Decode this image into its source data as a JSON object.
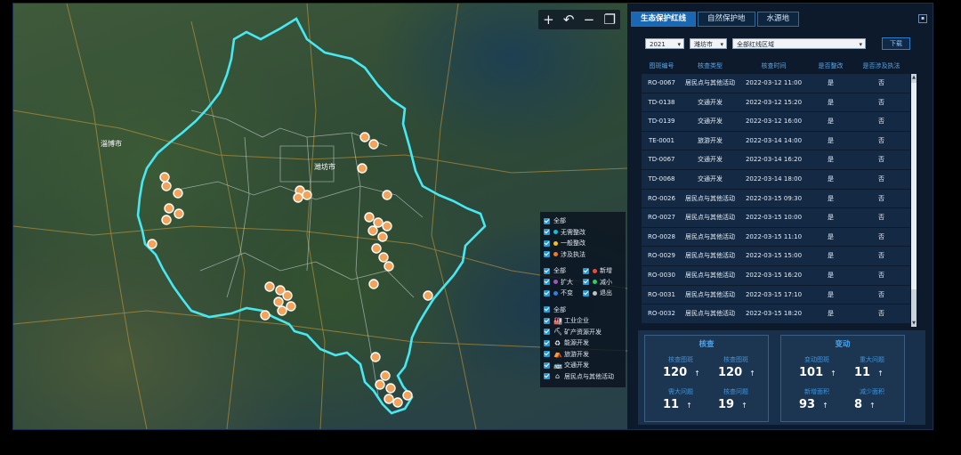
{
  "map": {
    "toolbar": [
      {
        "name": "zoom-in",
        "glyph": "+"
      },
      {
        "name": "undo",
        "glyph": "↶"
      },
      {
        "name": "zoom-out",
        "glyph": "−"
      },
      {
        "name": "layers",
        "glyph": "❐"
      }
    ],
    "city_labels": [
      {
        "name": "zibo",
        "text": "淄博市"
      },
      {
        "name": "weifang",
        "text": "潍坊市"
      }
    ],
    "legend": {
      "group1": [
        {
          "label": "全部",
          "dot": ""
        },
        {
          "label": "无需整改",
          "dot": "#1fb8d8"
        },
        {
          "label": "一般整改",
          "dot": "#f2c21b"
        },
        {
          "label": "涉及执法",
          "dot": "#f07a2a"
        }
      ],
      "group2": [
        [
          {
            "label": "全部",
            "dot": ""
          },
          {
            "label": "新增",
            "dot": "#e74c3c"
          }
        ],
        [
          {
            "label": "扩大",
            "dot": "#9b59b6"
          },
          {
            "label": "减小",
            "dot": "#2ecc71"
          }
        ],
        [
          {
            "label": "不变",
            "dot": "#3b7bdc"
          },
          {
            "label": "退出",
            "dot": "#bdc3c7"
          }
        ]
      ],
      "group3": [
        {
          "label": "全部",
          "icon": ""
        },
        {
          "label": "工业企业",
          "icon": "🏭"
        },
        {
          "label": "矿产资源开发",
          "icon": "⛏"
        },
        {
          "label": "能源开发",
          "icon": "♻"
        },
        {
          "label": "旅游开发",
          "icon": "⛺"
        },
        {
          "label": "交通开发",
          "icon": "🚌"
        },
        {
          "label": "居民点与其他活动",
          "icon": "⌂"
        }
      ]
    }
  },
  "panel": {
    "tabs": [
      "生态保护红线",
      "自然保护地",
      "水源地"
    ],
    "active_tab": 0,
    "filters": {
      "year": "2021",
      "city": "潍坊市",
      "area": "全部红线区域"
    },
    "download_label": "下载",
    "columns": [
      "图斑编号",
      "核查类型",
      "核查时间",
      "是否整改",
      "是否涉及执法"
    ],
    "rows": [
      [
        "RO-0067",
        "居民点与其他活动",
        "2022-03-12 11:00",
        "是",
        "否"
      ],
      [
        "TD-0138",
        "交通开发",
        "2022-03-12 15:20",
        "是",
        "否"
      ],
      [
        "TD-0139",
        "交通开发",
        "2022-03-12 16:00",
        "是",
        "否"
      ],
      [
        "TE-0001",
        "旅游开发",
        "2022-03-14 14:00",
        "是",
        "否"
      ],
      [
        "TD-0067",
        "交通开发",
        "2022-03-14 16:20",
        "是",
        "否"
      ],
      [
        "TD-0068",
        "交通开发",
        "2022-03-14 18:00",
        "是",
        "否"
      ],
      [
        "RO-0026",
        "居民点与其他活动",
        "2022-03-15 09:30",
        "是",
        "否"
      ],
      [
        "RO-0027",
        "居民点与其他活动",
        "2022-03-15 10:00",
        "是",
        "否"
      ],
      [
        "RO-0028",
        "居民点与其他活动",
        "2022-03-15 11:10",
        "是",
        "否"
      ],
      [
        "RO-0029",
        "居民点与其他活动",
        "2022-03-15 15:00",
        "是",
        "否"
      ],
      [
        "RO-0030",
        "居民点与其他活动",
        "2022-03-15 16:20",
        "是",
        "否"
      ],
      [
        "RO-0031",
        "居民点与其他活动",
        "2022-03-15 17:10",
        "是",
        "否"
      ],
      [
        "RO-0032",
        "居民点与其他活动",
        "2022-03-15 18:20",
        "是",
        "否"
      ]
    ],
    "summary": [
      {
        "title": "核查",
        "cells": [
          {
            "label": "核查图斑",
            "value": "120"
          },
          {
            "label": "核查图斑",
            "value": "120"
          },
          {
            "label": "需大问题",
            "value": "11"
          },
          {
            "label": "核查问题",
            "value": "19"
          }
        ]
      },
      {
        "title": "变动",
        "cells": [
          {
            "label": "变动图斑",
            "value": "101"
          },
          {
            "label": "重大问题",
            "value": "11"
          },
          {
            "label": "新增面积",
            "value": "93"
          },
          {
            "label": "减少面积",
            "value": "8"
          }
        ]
      }
    ],
    "trend_glyph": "↑"
  }
}
